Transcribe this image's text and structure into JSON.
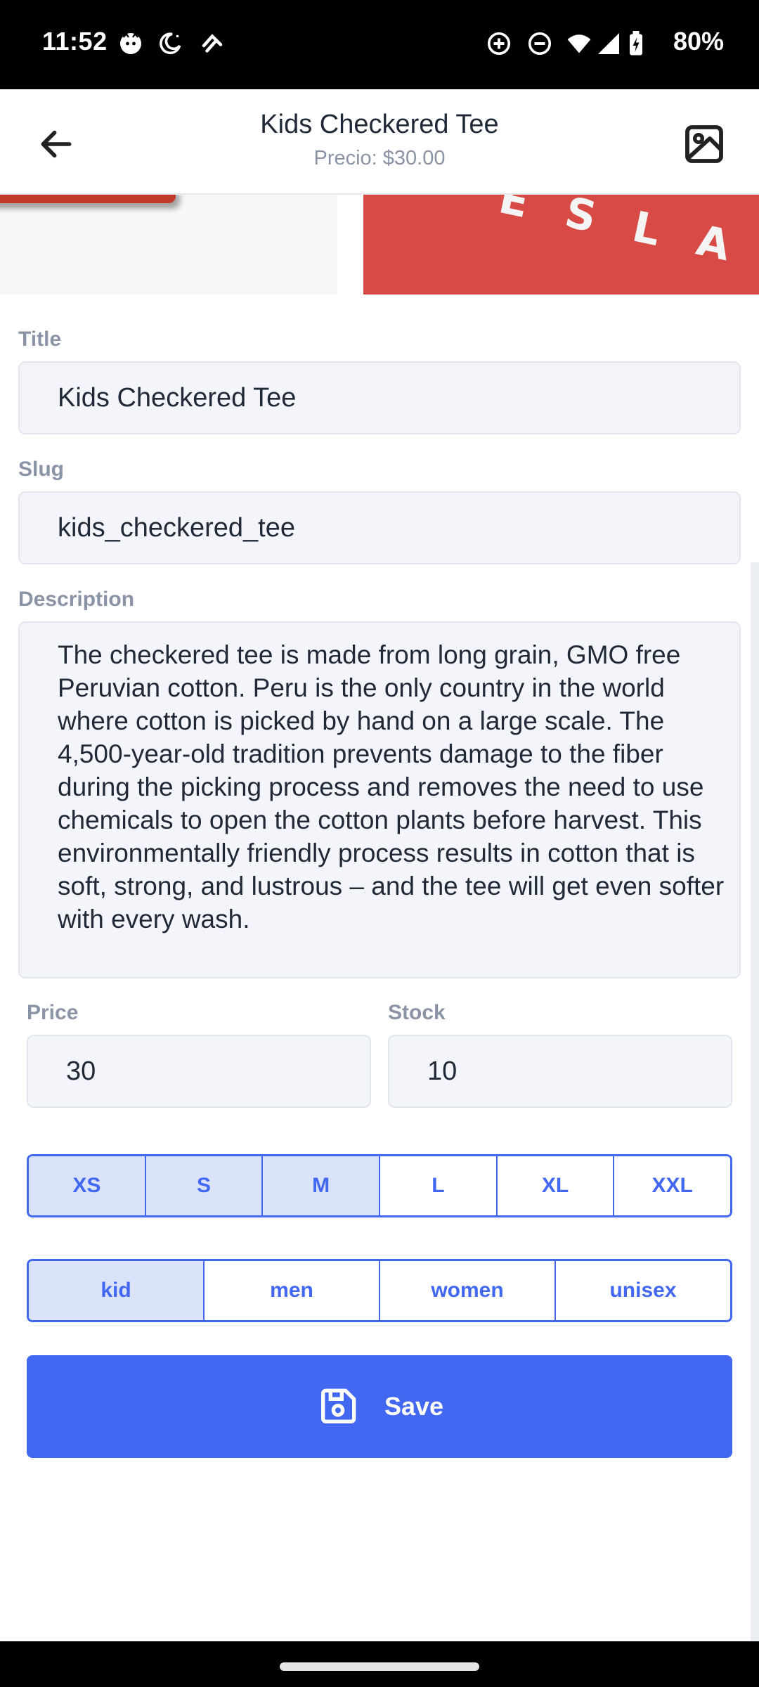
{
  "status_bar": {
    "time": "11:52",
    "battery_pct": "80%",
    "icons": [
      "face-icon",
      "moon-icon",
      "data-saver-icon",
      "add-circle-icon",
      "dnd-icon",
      "wifi-icon",
      "signal-icon",
      "battery-icon"
    ]
  },
  "header": {
    "title": "Kids Checkered Tee",
    "subtitle": "Precio: $30.00"
  },
  "images": {
    "right_logo_text": "ESLA"
  },
  "form": {
    "title_label": "Title",
    "title_value": "Kids Checkered Tee",
    "slug_label": "Slug",
    "slug_value": "kids_checkered_tee",
    "description_label": "Description",
    "description_value": "The checkered tee is made from long grain, GMO free Peruvian cotton. Peru is the only country in the world where cotton is picked by hand on a large scale. The 4,500-year-old tradition prevents damage to the fiber during the picking process and removes the need to use chemicals to open the cotton plants before harvest. This environmentally friendly process results in cotton that is soft, strong, and lustrous – and the tee will get even softer with every wash.",
    "price_label": "Price",
    "price_value": "30",
    "stock_label": "Stock",
    "stock_value": "10"
  },
  "sizes": [
    {
      "label": "XS",
      "selected": true
    },
    {
      "label": "S",
      "selected": true
    },
    {
      "label": "M",
      "selected": true
    },
    {
      "label": "L",
      "selected": false
    },
    {
      "label": "XL",
      "selected": false
    },
    {
      "label": "XXL",
      "selected": false
    }
  ],
  "genders": [
    {
      "label": "kid",
      "selected": true
    },
    {
      "label": "men",
      "selected": false
    },
    {
      "label": "women",
      "selected": false
    },
    {
      "label": "unisex",
      "selected": false
    }
  ],
  "save_label": "Save",
  "colors": {
    "accent": "#4267f0",
    "selected_bg": "#dbe3fb",
    "input_bg": "#f3f5fa",
    "label": "#8a94a6"
  }
}
